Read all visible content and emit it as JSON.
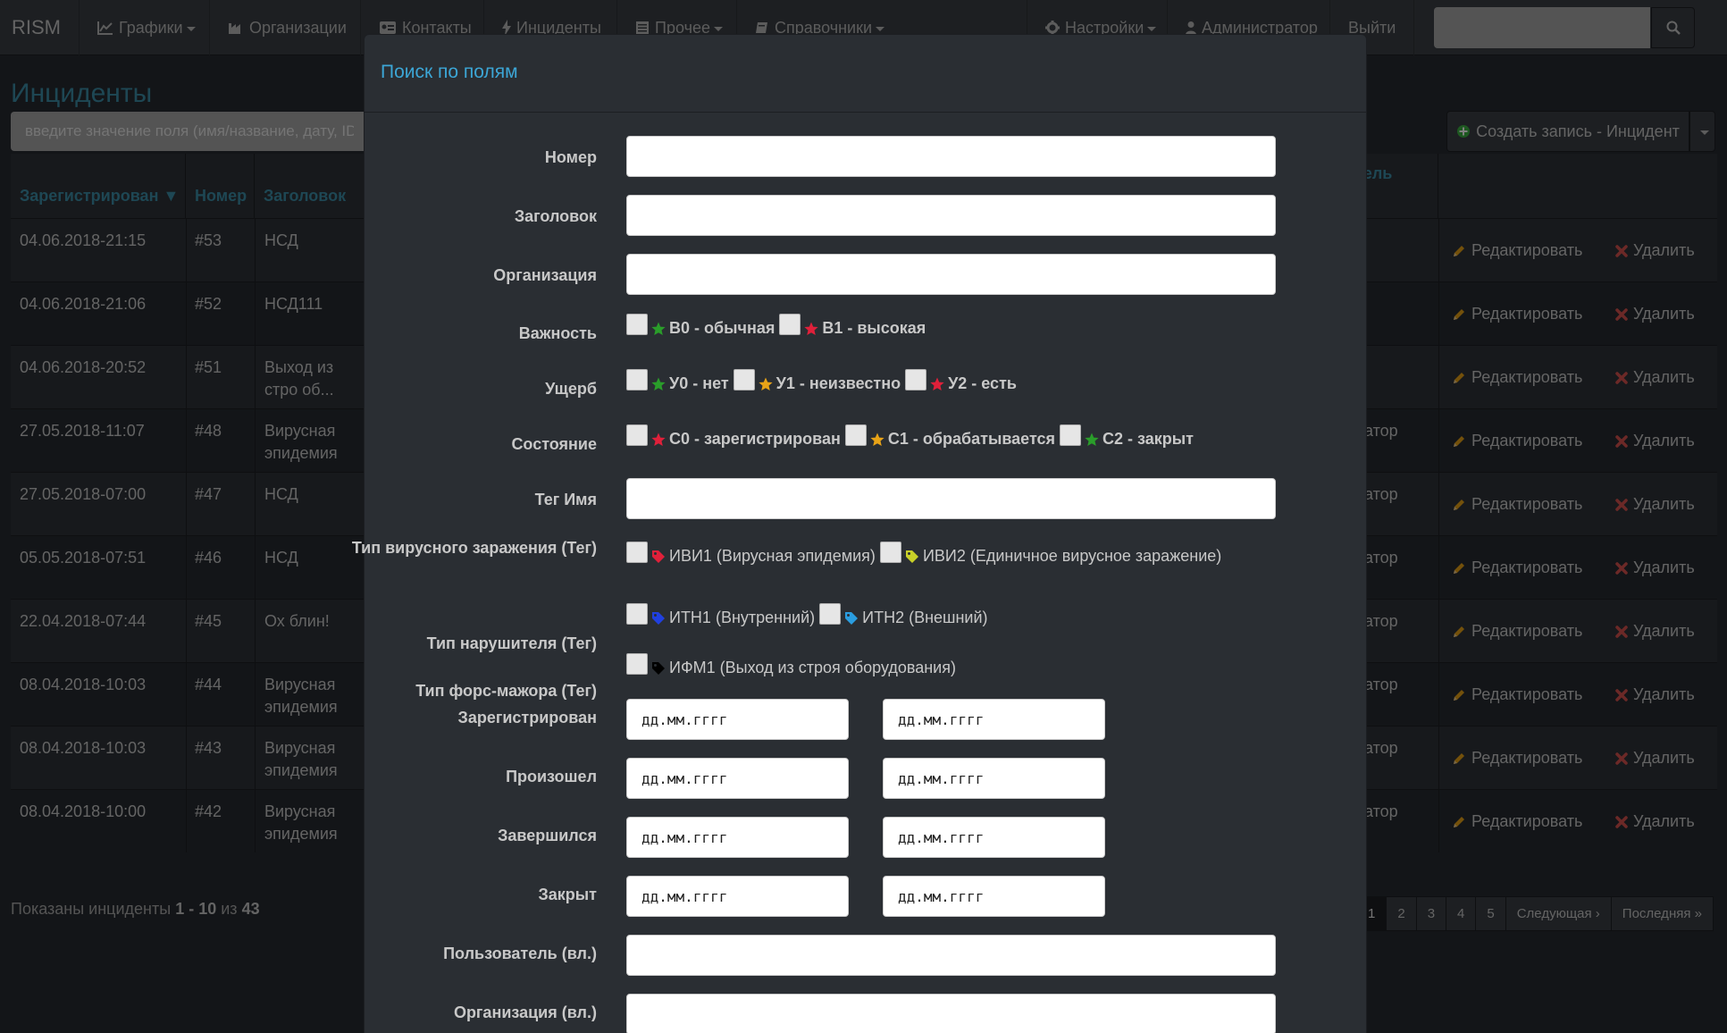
{
  "navbar": {
    "brand": "RISM",
    "items": [
      {
        "label": "Графики",
        "icon": "line-chart-icon"
      },
      {
        "label": "Организации",
        "icon": "factory-icon"
      },
      {
        "label": "Контакты",
        "icon": "address-card-icon"
      },
      {
        "label": "Инциденты",
        "icon": "bolt-icon"
      },
      {
        "label": "Прочее",
        "icon": "list-icon"
      },
      {
        "label": "Справочники",
        "icon": "book-icon"
      },
      {
        "label": "Настройки",
        "icon": "gear-icon"
      },
      {
        "label": "Администратор",
        "icon": "user-icon"
      },
      {
        "label": "Выйти",
        "icon": ""
      }
    ],
    "search_value": ""
  },
  "page": {
    "title": "Инциденты",
    "filter_placeholder": "введите значение поля (имя/название, дату, ID",
    "create_button": "Создать запись - Инцидент"
  },
  "table": {
    "columns": [
      "Зарегистрирован ▼",
      "Номер",
      "Заголовок",
      "тель"
    ],
    "rows": [
      {
        "date": "04.06.2018-21:15",
        "num": "#53",
        "title": "НСД",
        "user": ""
      },
      {
        "date": "04.06.2018-21:06",
        "num": "#52",
        "title": "НСД111",
        "user": ""
      },
      {
        "date": "04.06.2018-20:52",
        "num": "#51",
        "title": "Выход из стро об...",
        "user": ""
      },
      {
        "date": "27.05.2018-11:07",
        "num": "#48",
        "title": "Вирусная эпидемия",
        "user": "атор"
      },
      {
        "date": "27.05.2018-07:00",
        "num": "#47",
        "title": "НСД",
        "user": "атор"
      },
      {
        "date": "05.05.2018-07:51",
        "num": "#46",
        "title": "НСД",
        "user": "атор"
      },
      {
        "date": "22.04.2018-07:44",
        "num": "#45",
        "title": "Ох блин!",
        "user": "атор"
      },
      {
        "date": "08.04.2018-10:03",
        "num": "#44",
        "title": "Вирусная эпидемия",
        "user": "атор"
      },
      {
        "date": "08.04.2018-10:03",
        "num": "#43",
        "title": "Вирусная эпидемия",
        "user": "атор"
      },
      {
        "date": "08.04.2018-10:00",
        "num": "#42",
        "title": "Вирусная эпидемия",
        "user": "атор"
      }
    ],
    "edit_label": "Редактировать",
    "delete_label": "Удалить"
  },
  "footer": {
    "prefix": "Показаны инциденты",
    "range": "1 - 10",
    "of": "из",
    "total": "43"
  },
  "pagination": [
    "1",
    "2",
    "3",
    "4",
    "5",
    "Следующая ›",
    "Последняя »"
  ],
  "modal": {
    "title": "Поиск по полям",
    "labels": {
      "number": "Номер",
      "heading": "Заголовок",
      "organization": "Организация",
      "importance": "Важность",
      "damage": "Ущерб",
      "state": "Состояние",
      "tag_name": "Тег Имя",
      "virus_type": "Тип вирусного заражения (Тег)",
      "violator_type": "Тип нарушителя (Тег)",
      "force_type": "Тип форс-мажора (Тег)",
      "registered": "Зарегистрирован",
      "occurred": "Произошел",
      "finished": "Завершился",
      "closed": "Закрыт",
      "owner_user": "Пользователь (вл.)",
      "owner_org": "Организация (вл.)"
    },
    "importance_opts": [
      "В0 - обычная",
      "В1 - высокая"
    ],
    "damage_opts": [
      "У0 - нет",
      "У1 - неизвестно",
      "У2 - есть"
    ],
    "state_opts": [
      "С0 - зарегистрирован",
      "С1 - обрабатывается",
      "С2 - закрыт"
    ],
    "virus_opts": [
      "ИВИ1 (Вирусная эпидемия)",
      "ИВИ2 (Единичное вирусное заражение)"
    ],
    "violator_opts": [
      "ИТН1 (Внутренний)",
      "ИТН2 (Внешний)"
    ],
    "force_opts": [
      "ИФМ1 (Выход из строя оборудования)"
    ],
    "date_placeholder": "дд.мм.гггг"
  },
  "colors": {
    "accent": "#3c8fa8",
    "modal_title": "#3ca6d6",
    "star_green": "#2a9d2a",
    "star_red": "#e0203a",
    "star_yellow": "#e8a317",
    "delete_red": "#d9534f",
    "edit_orange": "#e8a317"
  }
}
